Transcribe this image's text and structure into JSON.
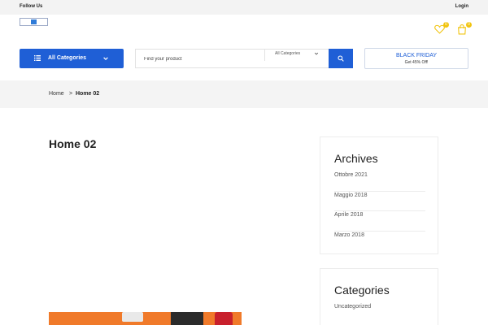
{
  "topbar": {
    "follow_label": "Follow Us",
    "login_label": "Login"
  },
  "header": {
    "wishlist_count": "0",
    "cart_count": "0",
    "all_categories_label": "All Categories",
    "search": {
      "placeholder": "Find your product",
      "category_selected": "All Categories"
    },
    "promo": {
      "title": "BLACK FRIDAY",
      "subtitle": "Get 45% Off!"
    }
  },
  "breadcrumb": {
    "home": "Home",
    "separator": ">",
    "current": "Home 02"
  },
  "main": {
    "title": "Home 02"
  },
  "sidebar": {
    "archives": {
      "title": "Archives",
      "items": [
        "Ottobre 2021",
        "Maggio 2018",
        "Aprile 2018",
        "Marzo 2018"
      ]
    },
    "categories": {
      "title": "Categories",
      "items": [
        "Uncategorized"
      ]
    }
  },
  "colors": {
    "brand": "#1f5fd6",
    "badge": "#f1c40f",
    "promo_text": "#1f5fd6"
  },
  "icons": [
    "menu-icon",
    "chevron-down-icon",
    "search-icon",
    "heart-icon",
    "bag-icon"
  ]
}
